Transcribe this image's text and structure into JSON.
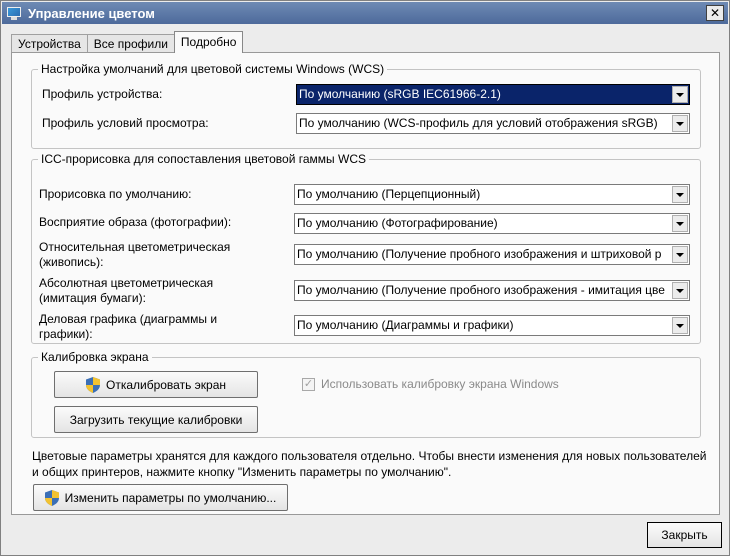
{
  "window": {
    "title": "Управление цветом",
    "close_glyph": "✕"
  },
  "tabs": [
    {
      "label": "Устройства",
      "active": false
    },
    {
      "label": "Все профили",
      "active": false
    },
    {
      "label": "Подробно",
      "active": true
    }
  ],
  "wcs_group": {
    "title": "Настройка умолчаний для цветовой системы Windows (WCS)",
    "device_profile_label": "Профиль устройства:",
    "device_profile_value": "По умолчанию (sRGB IEC61966-2.1)",
    "viewing_profile_label": "Профиль условий просмотра:",
    "viewing_profile_value": "По умолчанию (WCS-профиль для условий отображения sRGB)"
  },
  "icc_group": {
    "title": "ICC-прорисовка для сопоставления цветовой гаммы WCS",
    "rows": [
      {
        "label_line1": "Прорисовка по умолчанию:",
        "label_line2": "",
        "value": "По умолчанию (Перцепционный)"
      },
      {
        "label_line1": "Восприятие образа (фотографии):",
        "label_line2": "",
        "value": "По умолчанию (Фотографирование)"
      },
      {
        "label_line1": "Относительная цветометрическая",
        "label_line2": "(живопись):",
        "value": "По умолчанию (Получение пробного изображения и штриховой р"
      },
      {
        "label_line1": "Абсолютная цветометрическая",
        "label_line2": "(имитация бумаги):",
        "value": "По умолчанию (Получение пробного изображения - имитация цве"
      },
      {
        "label_line1": "Деловая графика (диаграммы и",
        "label_line2": "графики):",
        "value": "По умолчанию (Диаграммы и графики)"
      }
    ]
  },
  "calibration_group": {
    "title": "Калибровка экрана",
    "calibrate_button": "Откалибровать экран",
    "load_button": "Загрузить текущие калибровки",
    "use_windows_calibration_label": "Использовать калибровку экрана Windows",
    "use_windows_calibration_checked": true
  },
  "info_text": "Цветовые параметры хранятся для каждого пользователя отдельно. Чтобы внести изменения для новых пользователей и общих принтеров, нажмите кнопку \"Изменить параметры по умолчанию\".",
  "change_defaults_button": "Изменить параметры по умолчанию...",
  "close_button": "Закрыть",
  "colors": {
    "titlebar": "#4d6a9b",
    "selection": "#0a246a",
    "panel": "#fafafa",
    "window": "#ececec"
  },
  "icons": {
    "title": "monitor-icon",
    "shield": "uac-shield-icon"
  }
}
